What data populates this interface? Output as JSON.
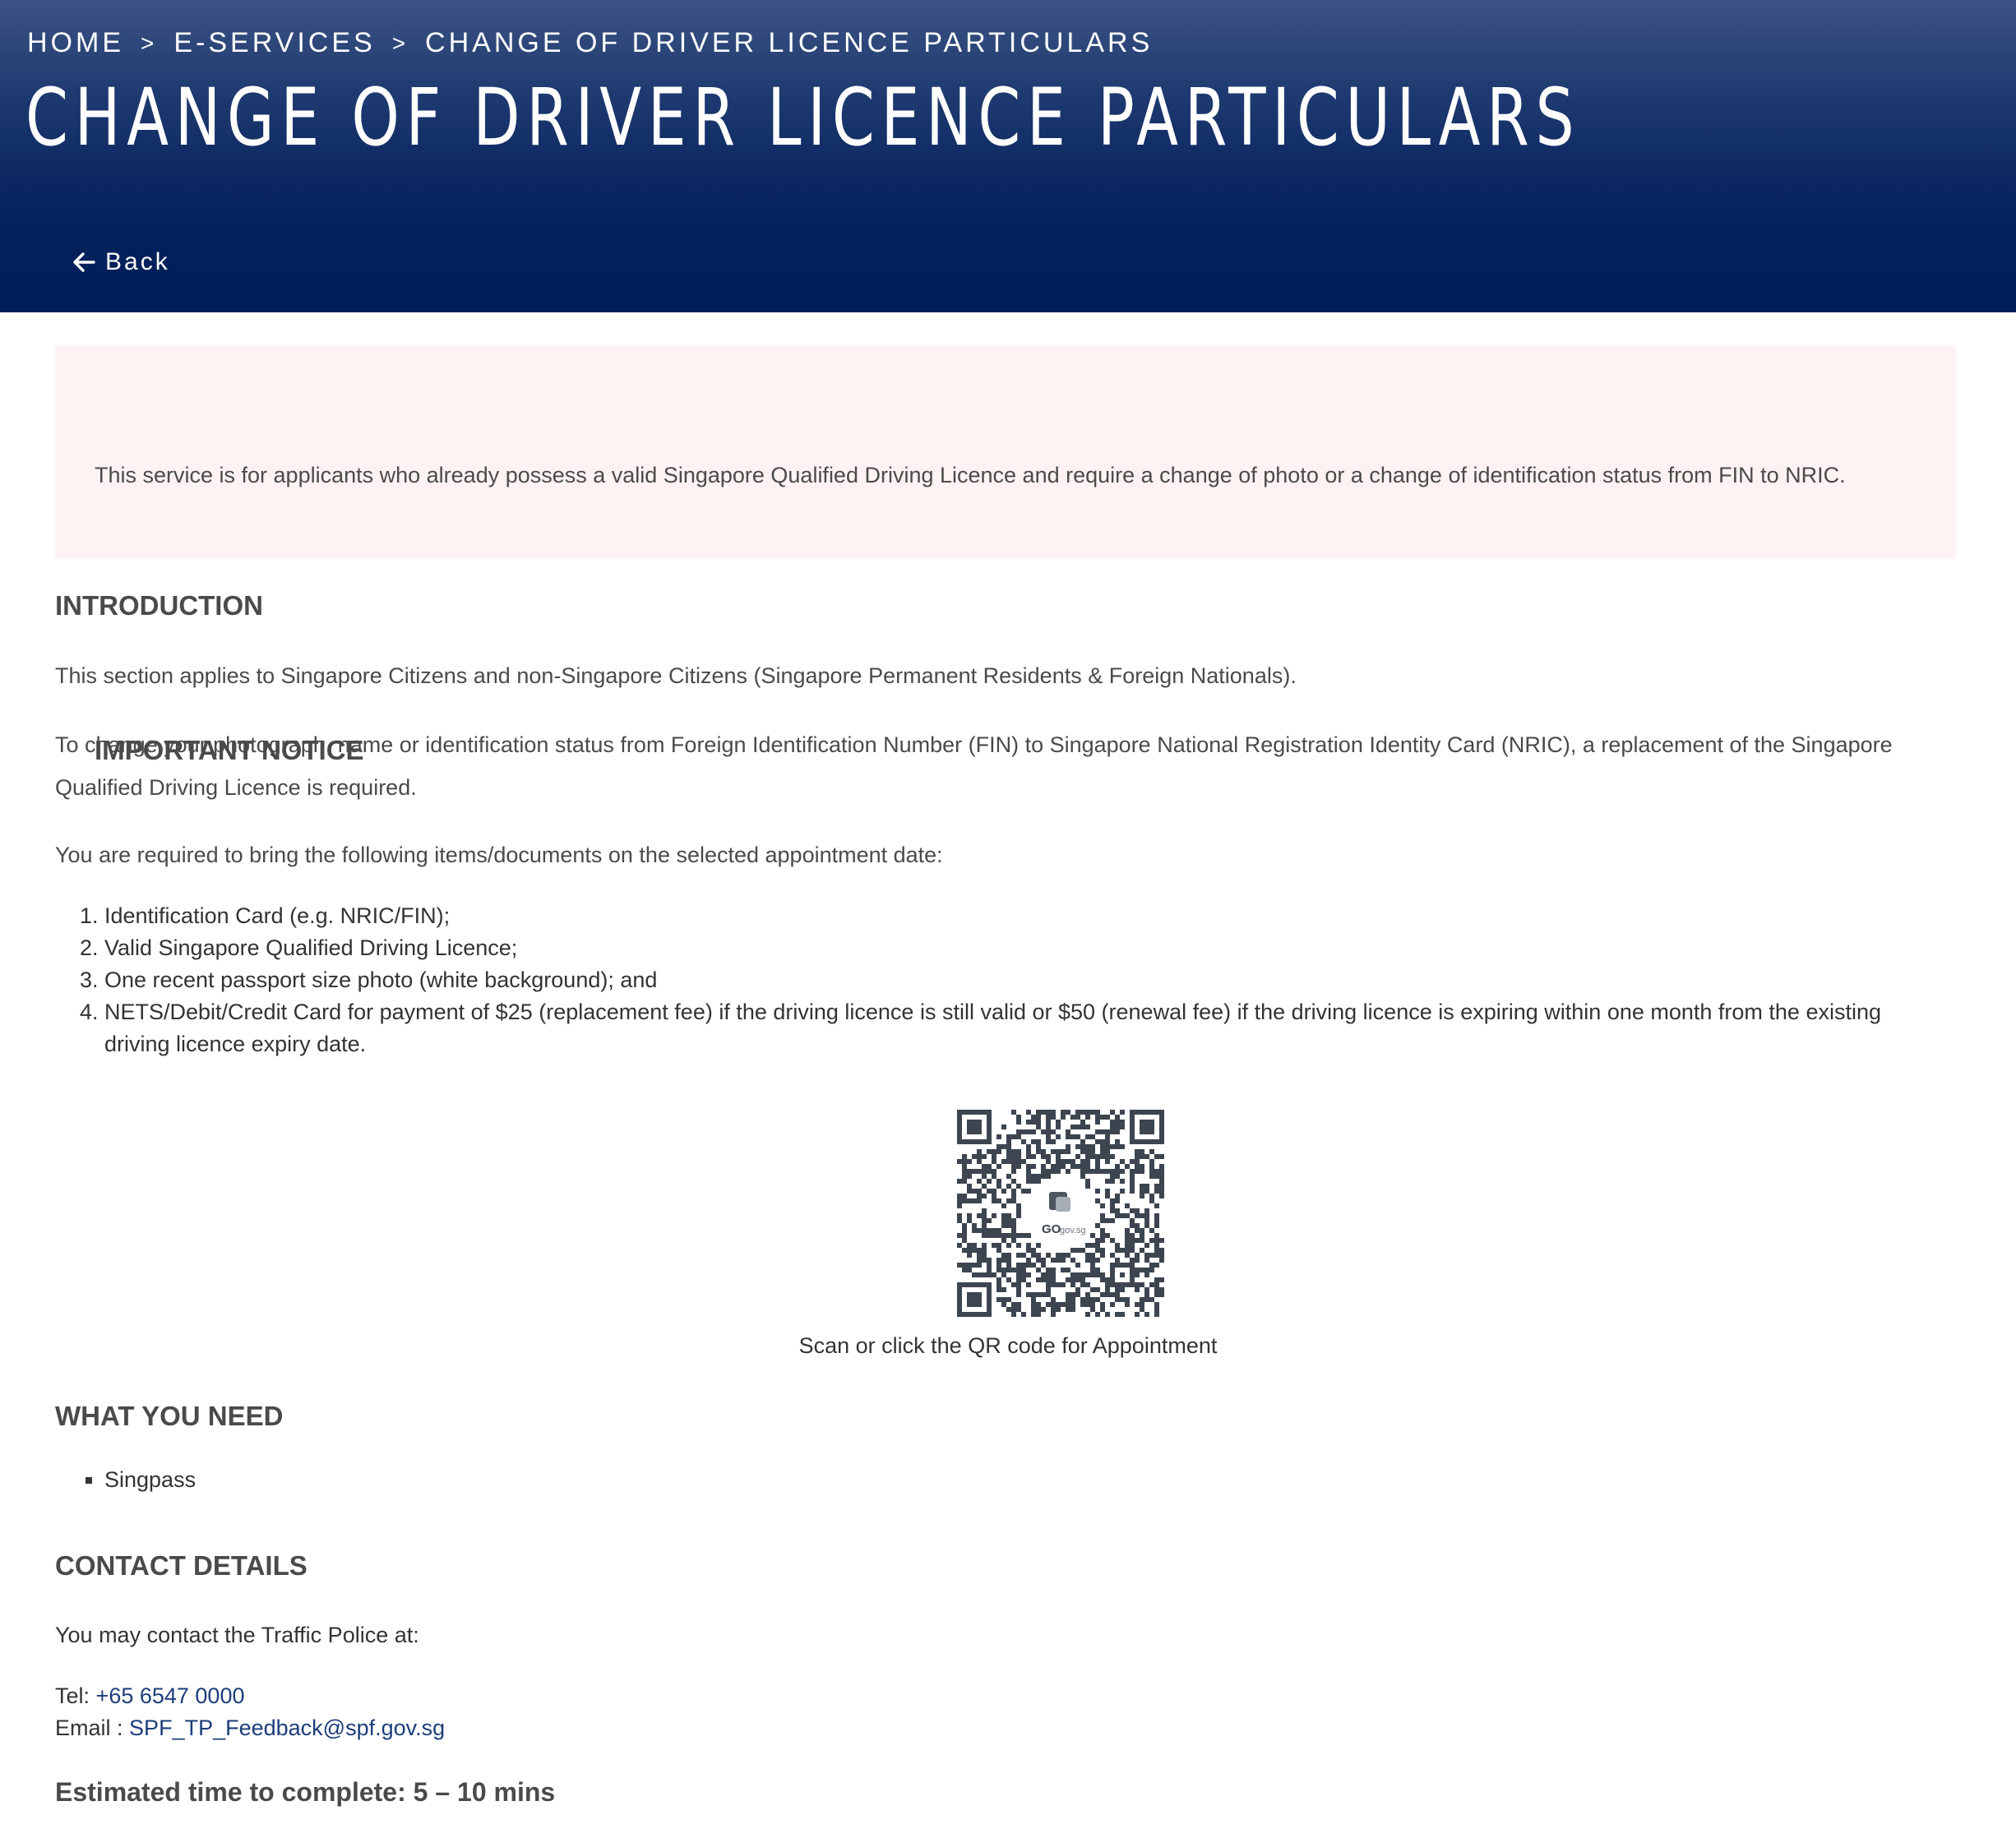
{
  "breadcrumb": {
    "home": "HOME",
    "eservices": "E-SERVICES",
    "current": "CHANGE OF DRIVER LICENCE PARTICULARS",
    "separator": ">"
  },
  "header": {
    "title": "CHANGE OF DRIVER LICENCE PARTICULARS",
    "back_label": "Back"
  },
  "notice": {
    "title": "IMPORTANT NOTICE",
    "text": "This service is for applicants who already possess a valid Singapore Qualified Driving Licence and require a change of photo or a change of identification status from FIN to NRIC."
  },
  "introduction": {
    "title": "INTRODUCTION",
    "para1": "This section applies to Singapore Citizens and non-Singapore Citizens (Singapore Permanent Residents & Foreign Nationals).",
    "para2": "To change your photograph, name or identification status from Foreign Identification Number (FIN) to Singapore National Registration Identity Card (NRIC), a replacement of the Singapore Qualified Driving Licence is required.",
    "para3": "You are required to bring the following items/documents on the selected appointment date:",
    "items": [
      "Identification Card (e.g. NRIC/FIN);",
      "Valid Singapore Qualified Driving Licence;",
      "One recent passport size photo (white background); and",
      "NETS/Debit/Credit Card for payment of $25 (replacement fee) if the driving licence is still valid or $50 (renewal fee) if the driving licence is expiring within one month from the existing driving licence expiry date."
    ]
  },
  "qr": {
    "logo_text": "GO",
    "logo_sub": "gov.sg",
    "caption": "Scan or click the QR code for Appointment"
  },
  "needs": {
    "title": "WHAT YOU NEED",
    "items": [
      "Singpass"
    ]
  },
  "contact": {
    "title": "CONTACT DETAILS",
    "intro": "You may contact the Traffic Police at:",
    "tel_label": "Tel:",
    "tel_value": "+65 6547 0000",
    "email_label": "Email :",
    "email_value": "SPF_TP_Feedback@spf.gov.sg"
  },
  "estimate": "Estimated time to complete: 5 – 10 mins",
  "colors": {
    "header_dark": "#001f5a",
    "notice_bg": "#fef2f2",
    "link": "#1c3d7a"
  }
}
